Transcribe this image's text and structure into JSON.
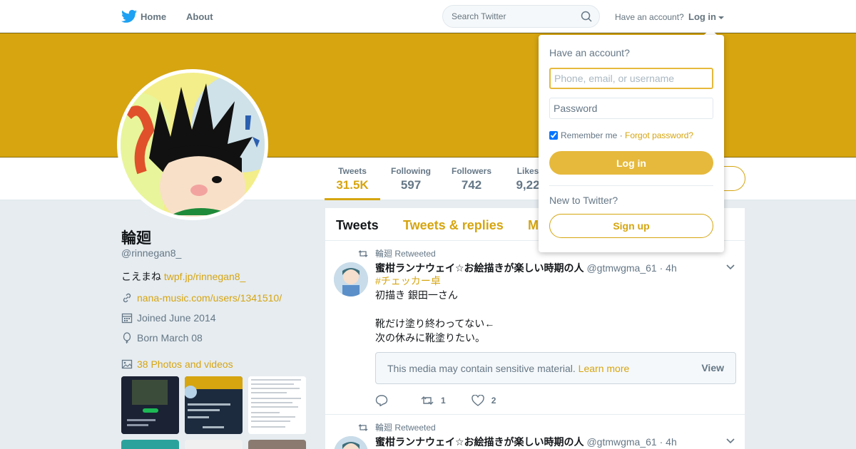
{
  "nav": {
    "home_label": "Home",
    "about_label": "About",
    "search_placeholder": "Search Twitter",
    "have_account": "Have an account?",
    "login_label": "Log in"
  },
  "colors": {
    "accent": "#d6a510",
    "banner": "#d6a510",
    "button": "#e6b93c"
  },
  "stats": [
    {
      "label": "Tweets",
      "value": "31.5K",
      "active": true
    },
    {
      "label": "Following",
      "value": "597"
    },
    {
      "label": "Followers",
      "value": "742"
    },
    {
      "label": "Likes",
      "value": "9,22"
    }
  ],
  "profile": {
    "name": "輪廻",
    "handle": "@rinnegan8_",
    "bio_text": "こえまね",
    "bio_link": "twpf.jp/rinnegan8_",
    "website": "nana-music.com/users/1341510/",
    "joined": "Joined June 2014",
    "born": "Born March 08",
    "photos": "38 Photos and videos"
  },
  "timeline": {
    "tabs": [
      "Tweets",
      "Tweets & replies",
      "M"
    ],
    "tweets": [
      {
        "retweeted_by": "輪廻 Retweeted",
        "name": "蜜柑ランナウェイ☆お絵描きが楽しい時期の人",
        "handle": "@gtmwgma_61",
        "dot": "·",
        "time": "4h",
        "hashtag": "#チェッカー卓",
        "line1": "初描き 銀田一さん",
        "line2": "靴だけ塗り終わってない←",
        "line3": "次の休みに靴塗りたい。",
        "sensitive_msg": "This media may contain sensitive material.",
        "learn_more": "Learn more",
        "view": "View",
        "retweets": "1",
        "likes": "2"
      },
      {
        "retweeted_by": "輪廻 Retweeted",
        "name": "蜜柑ランナウェイ☆お絵描きが楽しい時期の人",
        "handle": "@gtmwgma_61",
        "dot": "·",
        "time": "4h"
      }
    ]
  },
  "login_dropdown": {
    "title": "Have an account?",
    "username_placeholder": "Phone, email, or username",
    "password_placeholder": "Password",
    "remember_me": "Remember me",
    "separator": "·",
    "forgot": "Forgot password?",
    "login_button": "Log in",
    "new_to": "New to Twitter?",
    "signup_button": "Sign up"
  }
}
